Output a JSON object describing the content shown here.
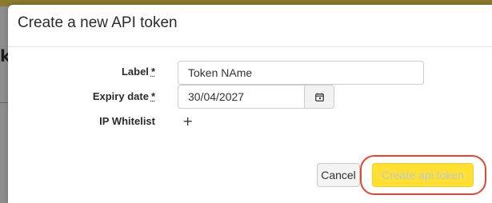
{
  "backdrop": {
    "partial_text": "k"
  },
  "modal": {
    "title": "Create a new API token"
  },
  "form": {
    "label_field": {
      "label": "Label",
      "required_marker": "*",
      "value": "Token NAme"
    },
    "expiry_field": {
      "label": "Expiry date",
      "required_marker": "*",
      "value": "30/04/2027",
      "icon": "calendar-icon"
    },
    "ip_whitelist": {
      "label": "IP Whitelist",
      "add_symbol": "+",
      "icon": "plus-icon"
    }
  },
  "footer": {
    "cancel_label": "Cancel",
    "create_label": "Create api token"
  },
  "colors": {
    "primary_button": "#ffe033",
    "highlight_ring": "#e0472e"
  }
}
